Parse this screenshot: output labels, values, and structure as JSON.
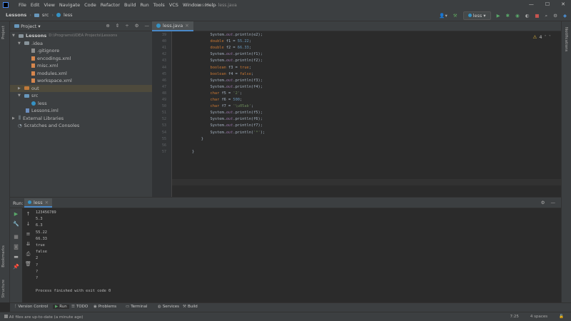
{
  "window": {
    "menu_items": [
      "File",
      "Edit",
      "View",
      "Navigate",
      "Code",
      "Refactor",
      "Build",
      "Run",
      "Tools",
      "VCS",
      "Window",
      "Help"
    ],
    "title": "Lessons - less.java",
    "controls": [
      "—",
      "☐",
      "✕"
    ]
  },
  "navbar": {
    "crumb_project": "Lessons",
    "crumb_src": "src",
    "crumb_file": "less",
    "run_config": "less"
  },
  "left_stripe": {
    "project_tab": "Project",
    "bookmarks_tab": "Bookmarks",
    "structure_tab": "Structure"
  },
  "right_stripe": {
    "notifications_tab": "Notifications"
  },
  "project_panel": {
    "title": "Project",
    "root_name": "Lessons",
    "root_path": "D:\\Programs\\IDEA Projects\\Lessons",
    "idea_folder": ".idea",
    "idea_files": [
      ".gitignore",
      "encodings.xml",
      "misc.xml",
      "modules.xml",
      "workspace.xml"
    ],
    "out_folder": "out",
    "src_folder": "src",
    "src_file": "less",
    "iml_file": "Lessons.iml",
    "external_libraries": "External Libraries",
    "scratches": "Scratches and Consoles"
  },
  "editor": {
    "tab_label": "less.java",
    "warnings_count": "4",
    "line_numbers": [
      "39",
      "40",
      "41",
      "42",
      "43",
      "44",
      "45",
      "46",
      "47",
      "48",
      "49",
      "50",
      "51",
      "52",
      "53",
      "54",
      "55",
      "56",
      "57"
    ],
    "code_lines": [
      {
        "indent": "        ",
        "parts": [
          [
            "plain",
            "System."
          ],
          [
            "fld",
            "out"
          ],
          [
            "plain",
            ".println(e2);"
          ]
        ]
      },
      {
        "indent": "        ",
        "parts": [
          [
            "kw",
            "double "
          ],
          [
            "plain",
            "f1 = "
          ],
          [
            "num",
            "55.22"
          ],
          [
            "plain",
            ";"
          ]
        ]
      },
      {
        "indent": "        ",
        "parts": [
          [
            "kw",
            "double "
          ],
          [
            "plain",
            "f2 = "
          ],
          [
            "num",
            "66.33"
          ],
          [
            "plain",
            ";"
          ]
        ]
      },
      {
        "indent": "        ",
        "parts": [
          [
            "plain",
            "System."
          ],
          [
            "fld",
            "out"
          ],
          [
            "plain",
            ".println(f1);"
          ]
        ]
      },
      {
        "indent": "        ",
        "parts": [
          [
            "plain",
            "System."
          ],
          [
            "fld",
            "out"
          ],
          [
            "plain",
            ".println(f2);"
          ]
        ]
      },
      {
        "indent": "        ",
        "parts": [
          [
            "kw",
            "boolean "
          ],
          [
            "plain",
            "f3 = "
          ],
          [
            "kw",
            "true"
          ],
          [
            "plain",
            ";"
          ]
        ]
      },
      {
        "indent": "        ",
        "parts": [
          [
            "kw",
            "boolean "
          ],
          [
            "plain",
            "f4 = "
          ],
          [
            "kw",
            "false"
          ],
          [
            "plain",
            ";"
          ]
        ]
      },
      {
        "indent": "        ",
        "parts": [
          [
            "plain",
            "System."
          ],
          [
            "fld",
            "out"
          ],
          [
            "plain",
            ".println(f3);"
          ]
        ]
      },
      {
        "indent": "        ",
        "parts": [
          [
            "plain",
            "System."
          ],
          [
            "fld",
            "out"
          ],
          [
            "plain",
            ".println(f4);"
          ]
        ]
      },
      {
        "indent": "        ",
        "parts": [
          [
            "kw",
            "char "
          ],
          [
            "plain",
            "f5 = "
          ],
          [
            "str",
            "'2'"
          ],
          [
            "plain",
            ";"
          ]
        ]
      },
      {
        "indent": "        ",
        "parts": [
          [
            "kw",
            "char "
          ],
          [
            "plain",
            "f6 = "
          ],
          [
            "num",
            "500"
          ],
          [
            "plain",
            ";"
          ]
        ]
      },
      {
        "indent": "        ",
        "parts": [
          [
            "kw",
            "char "
          ],
          [
            "plain",
            "f7 = "
          ],
          [
            "str",
            "'\\u05ab'"
          ],
          [
            "plain",
            ";"
          ]
        ]
      },
      {
        "indent": "        ",
        "parts": [
          [
            "plain",
            "System."
          ],
          [
            "fld",
            "out"
          ],
          [
            "plain",
            ".println(f5);"
          ]
        ]
      },
      {
        "indent": "        ",
        "parts": [
          [
            "plain",
            "System."
          ],
          [
            "fld",
            "out"
          ],
          [
            "plain",
            ".println(f6);"
          ]
        ]
      },
      {
        "indent": "        ",
        "parts": [
          [
            "plain",
            "System."
          ],
          [
            "fld",
            "out"
          ],
          [
            "plain",
            ".println(f7);"
          ]
        ]
      },
      {
        "indent": "        ",
        "parts": [
          [
            "plain",
            "System."
          ],
          [
            "fld",
            "out"
          ],
          [
            "plain",
            ".println("
          ],
          [
            "str",
            "'*'"
          ],
          [
            "plain",
            ");"
          ]
        ]
      },
      {
        "indent": "    ",
        "parts": [
          [
            "plain",
            "}"
          ]
        ]
      },
      {
        "indent": "",
        "parts": [
          [
            "plain",
            ""
          ]
        ]
      },
      {
        "indent": "",
        "parts": [
          [
            "plain",
            "}"
          ]
        ]
      }
    ]
  },
  "run_panel": {
    "label": "Run:",
    "tab_label": "less",
    "output_lines": [
      "123456789",
      "5.3",
      "6.3",
      "55.22",
      "66.33",
      "true",
      "false",
      "2",
      "?",
      "?",
      "?",
      "",
      "Process finished with exit code 0"
    ]
  },
  "bottom_tools": [
    {
      "icon": "vcs-icon",
      "label": "Version Control"
    },
    {
      "icon": "run-icon",
      "label": "Run"
    },
    {
      "icon": "todo-icon",
      "label": "TODO"
    },
    {
      "icon": "problems-icon",
      "label": "Problems"
    },
    {
      "icon": "terminal-icon",
      "label": "Terminal"
    },
    {
      "icon": "services-icon",
      "label": "Services"
    },
    {
      "icon": "build-icon",
      "label": "Build"
    }
  ],
  "status": {
    "message": "All files are up-to-date (a minute ago)",
    "position": "7:25",
    "indent": "4 spaces"
  },
  "colors": {
    "background": "#2b2b2b",
    "panel": "#3c3f41",
    "keyword": "#cc7832",
    "number": "#6897bb",
    "string": "#6a8759",
    "field": "#9876aa"
  }
}
